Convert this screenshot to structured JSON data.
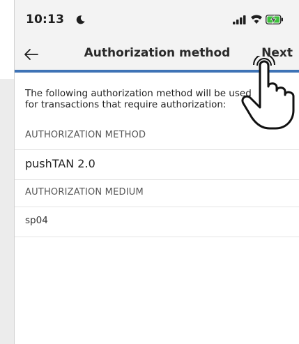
{
  "status_bar": {
    "time": "10:13"
  },
  "nav": {
    "back_icon": "arrow-left-icon",
    "title": "Authorization method",
    "next_label": "Next"
  },
  "content": {
    "intro": "The following authorization method will be used for transactions that require authorization:",
    "method_header": "AUTHORIZATION METHOD",
    "method_value": "pushTAN 2.0",
    "medium_header": "AUTHORIZATION MEDIUM",
    "medium_value": "sp04"
  },
  "colors": {
    "accent": "#3e73b6",
    "battery": "#3cc13b"
  }
}
